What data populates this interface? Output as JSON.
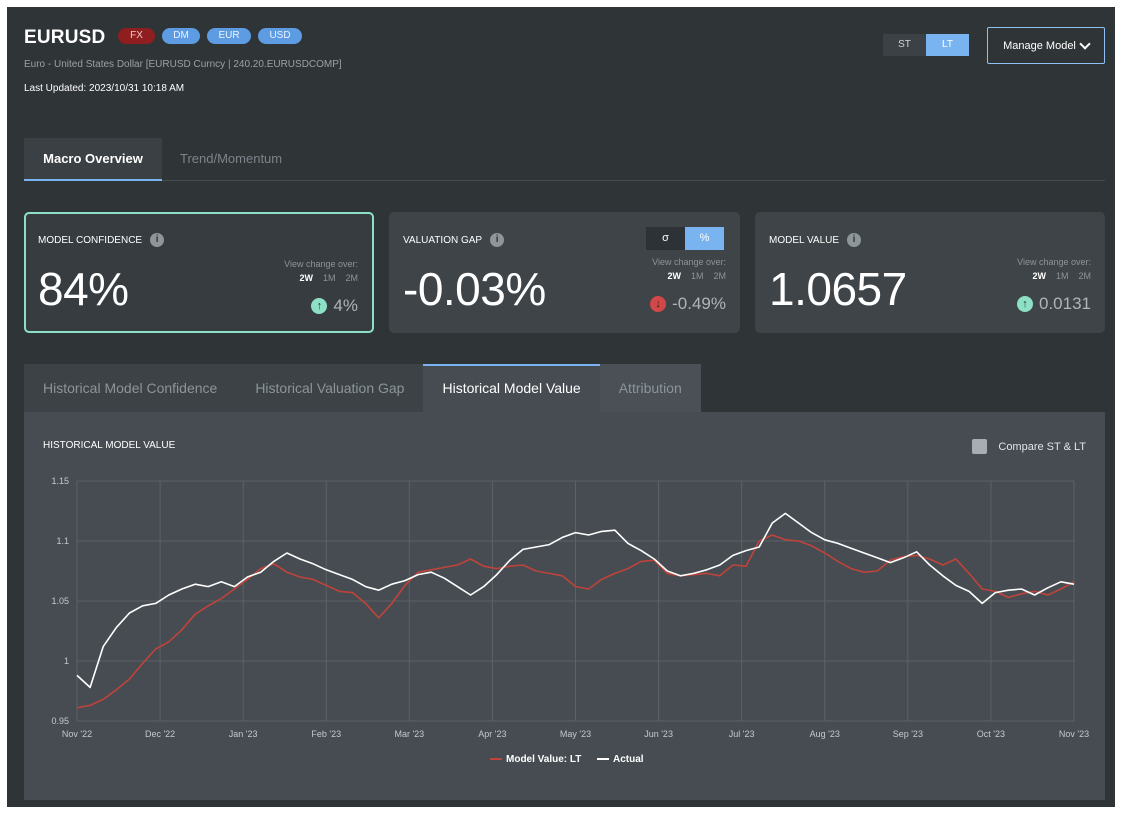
{
  "header": {
    "ticker": "EURUSD",
    "badges": [
      "FX",
      "DM",
      "EUR",
      "USD"
    ],
    "subtitle": "Euro - United States Dollar [EURUSD Curncy | 240.20.EURUSDCOMP]",
    "last_updated": "Last Updated: 2023/10/31 10:18 AM",
    "horizon": {
      "options": [
        "ST",
        "LT"
      ],
      "selected": "LT"
    },
    "manage_button": "Manage Model"
  },
  "main_tabs": [
    {
      "label": "Macro Overview",
      "active": true
    },
    {
      "label": "Trend/Momentum",
      "active": false
    }
  ],
  "cards": [
    {
      "label": "MODEL CONFIDENCE",
      "value": "84%",
      "view_change_label": "View change over:",
      "periods": [
        "2W",
        "1M",
        "2M"
      ],
      "selected_period": "2W",
      "change": "4%",
      "direction": "up"
    },
    {
      "label": "VALUATION GAP",
      "value": "-0.03%",
      "toggle": [
        "σ",
        "%"
      ],
      "toggle_selected": "%",
      "view_change_label": "View change over:",
      "periods": [
        "2W",
        "1M",
        "2M"
      ],
      "selected_period": "2W",
      "change": "-0.49%",
      "direction": "down"
    },
    {
      "label": "MODEL VALUE",
      "value": "1.0657",
      "view_change_label": "View change over:",
      "periods": [
        "2W",
        "1M",
        "2M"
      ],
      "selected_period": "2W",
      "change": "0.0131",
      "direction": "up"
    }
  ],
  "sub_tabs": [
    {
      "label": "Historical Model Confidence",
      "active": false
    },
    {
      "label": "Historical Valuation Gap",
      "active": false
    },
    {
      "label": "Historical Model Value",
      "active": true
    },
    {
      "label": "Attribution",
      "active": false
    }
  ],
  "panel": {
    "title": "HISTORICAL MODEL VALUE",
    "compare_label": "Compare ST & LT",
    "compare_checked": false
  },
  "colors": {
    "background": "#2f3437",
    "accent": "#7ab4f0",
    "positive": "#8de0c6",
    "negative": "#d24848",
    "model_line": "#c0433b",
    "actual_line": "#ffffff"
  },
  "chart_data": {
    "type": "line",
    "title": "HISTORICAL MODEL VALUE",
    "xlabel": "",
    "ylabel": "",
    "ylim": [
      0.95,
      1.15
    ],
    "yticks": [
      0.95,
      1,
      1.05,
      1.1,
      1.15
    ],
    "ytick_labels": [
      "0.95",
      "1",
      "1.05",
      "1.1",
      "1.15"
    ],
    "xticks": [
      "Nov '22",
      "Dec '22",
      "Jan '23",
      "Feb '23",
      "Mar '23",
      "Apr '23",
      "May '23",
      "Jun '23",
      "Jul '23",
      "Aug '23",
      "Sep '23",
      "Oct '23",
      "Nov '23"
    ],
    "grid": true,
    "legend_position": "bottom-center",
    "series": [
      {
        "name": "Model Value: LT",
        "color": "#c0433b",
        "values": [
          0.961,
          0.963,
          0.968,
          0.976,
          0.985,
          0.998,
          1.01,
          1.016,
          1.026,
          1.039,
          1.046,
          1.052,
          1.06,
          1.068,
          1.077,
          1.081,
          1.074,
          1.07,
          1.068,
          1.063,
          1.058,
          1.057,
          1.048,
          1.036,
          1.048,
          1.063,
          1.074,
          1.076,
          1.078,
          1.08,
          1.085,
          1.079,
          1.077,
          1.079,
          1.08,
          1.075,
          1.073,
          1.071,
          1.062,
          1.06,
          1.068,
          1.073,
          1.077,
          1.083,
          1.084,
          1.073,
          1.071,
          1.072,
          1.073,
          1.071,
          1.08,
          1.079,
          1.1,
          1.105,
          1.101,
          1.1,
          1.096,
          1.09,
          1.083,
          1.077,
          1.074,
          1.075,
          1.084,
          1.087,
          1.088,
          1.085,
          1.08,
          1.085,
          1.073,
          1.06,
          1.058,
          1.053,
          1.056,
          1.058,
          1.055,
          1.06,
          1.066
        ]
      },
      {
        "name": "Actual",
        "color": "#ffffff",
        "values": [
          0.988,
          0.978,
          1.012,
          1.028,
          1.04,
          1.046,
          1.048,
          1.055,
          1.06,
          1.064,
          1.062,
          1.066,
          1.062,
          1.07,
          1.074,
          1.083,
          1.09,
          1.085,
          1.081,
          1.076,
          1.072,
          1.068,
          1.062,
          1.059,
          1.064,
          1.067,
          1.072,
          1.074,
          1.069,
          1.062,
          1.055,
          1.062,
          1.072,
          1.084,
          1.093,
          1.095,
          1.097,
          1.103,
          1.107,
          1.105,
          1.108,
          1.109,
          1.098,
          1.092,
          1.085,
          1.075,
          1.071,
          1.073,
          1.076,
          1.08,
          1.088,
          1.092,
          1.095,
          1.115,
          1.123,
          1.115,
          1.107,
          1.101,
          1.098,
          1.094,
          1.09,
          1.086,
          1.082,
          1.086,
          1.091,
          1.08,
          1.071,
          1.063,
          1.058,
          1.048,
          1.057,
          1.059,
          1.06,
          1.055,
          1.061,
          1.066,
          1.064
        ]
      }
    ]
  }
}
